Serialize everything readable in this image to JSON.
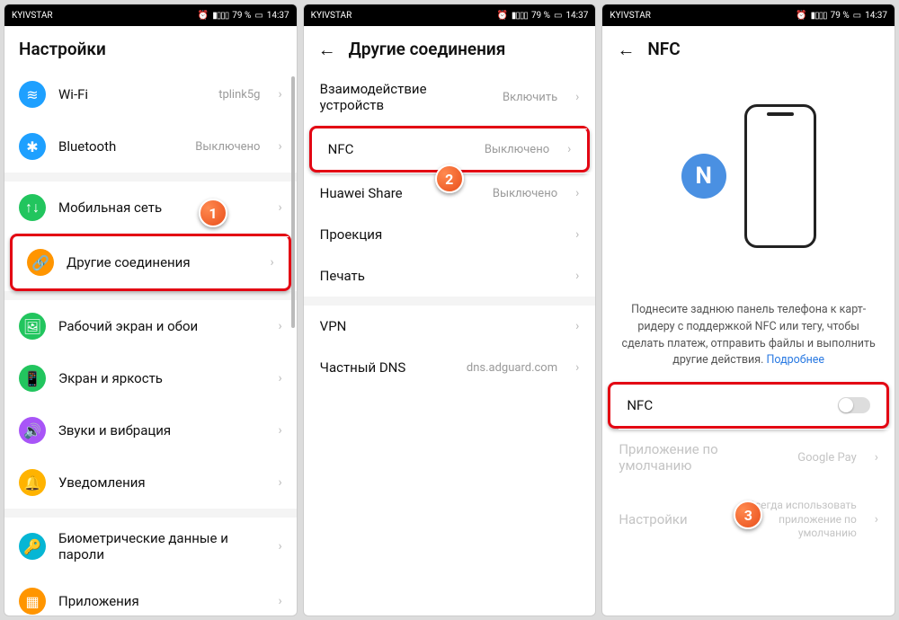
{
  "status": {
    "carrier": "KYIVSTAR",
    "battery": "79 %",
    "time": "14:37"
  },
  "screen1": {
    "title": "Настройки",
    "items": [
      {
        "label": "Wi-Fi",
        "value": "tplink5g",
        "color": "#1ea0ff",
        "icon": "≋"
      },
      {
        "label": "Bluetooth",
        "value": "Выключено",
        "color": "#1ea0ff",
        "icon": "✱"
      },
      {
        "label": "Мобильная сеть",
        "value": "",
        "color": "#22c55e",
        "icon": "↑↓"
      },
      {
        "label": "Другие соединения",
        "value": "",
        "color": "#ff9500",
        "icon": "🔗"
      },
      {
        "label": "Рабочий экран и обои",
        "value": "",
        "color": "#22c55e",
        "icon": "🖼"
      },
      {
        "label": "Экран и яркость",
        "value": "",
        "color": "#22c55e",
        "icon": "📱"
      },
      {
        "label": "Звуки и вибрация",
        "value": "",
        "color": "#a855f7",
        "icon": "🔊"
      },
      {
        "label": "Уведомления",
        "value": "",
        "color": "#ffb300",
        "icon": "🔔"
      },
      {
        "label": "Биометрические данные и пароли",
        "value": "",
        "color": "#06b6d4",
        "icon": "🔑"
      },
      {
        "label": "Приложения",
        "value": "",
        "color": "#ff9500",
        "icon": "▦"
      }
    ]
  },
  "screen2": {
    "title": "Другие соединения",
    "group1": [
      {
        "label": "Взаимодействие устройств",
        "value": "Включить"
      },
      {
        "label": "NFC",
        "value": "Выключено"
      },
      {
        "label": "Huawei Share",
        "value": "Выключено"
      },
      {
        "label": "Проекция",
        "value": ""
      },
      {
        "label": "Печать",
        "value": ""
      }
    ],
    "group2": [
      {
        "label": "VPN",
        "value": ""
      },
      {
        "label": "Частный DNS",
        "value": "dns.adguard.com"
      }
    ]
  },
  "screen3": {
    "title": "NFC",
    "desc_main": "Поднесите заднюю панель телефона к карт-ридеру с поддержкой NFC или тегу, чтобы сделать платеж, отправить файлы и выполнить другие действия. ",
    "desc_link": "Подробнее",
    "nfc_label": "NFC",
    "app_label": "Приложение по умолчанию",
    "app_value": "Google Pay",
    "settings_label": "Настройки",
    "settings_value": "Всегда использовать приложение по умолчанию"
  },
  "badges": {
    "b1": "1",
    "b2": "2",
    "b3": "3"
  }
}
